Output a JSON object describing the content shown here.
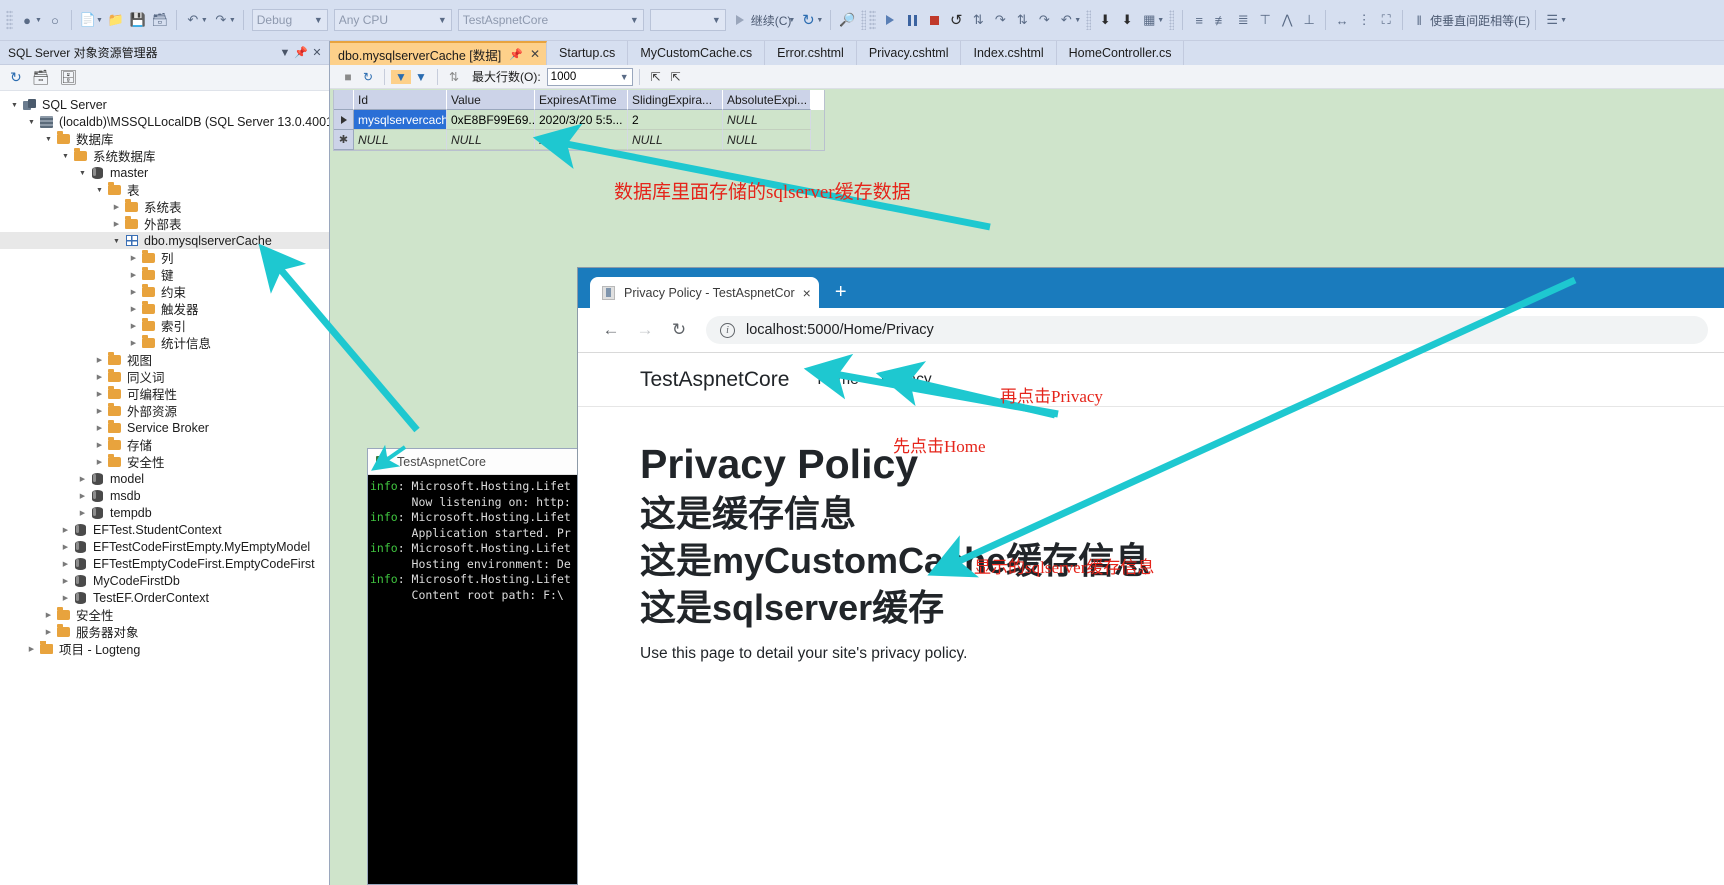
{
  "ide": {
    "toolbar": {
      "config_value": "Debug",
      "platform_value": "Any CPU",
      "startup_project_value": "TestAspnetCore",
      "empty_combo_value": "",
      "continue_label": "继续(C)",
      "spacing_label": "使垂直间距相等(E)"
    },
    "explorer": {
      "title": "SQL Server 对象资源管理器",
      "tree": [
        {
          "depth": 0,
          "label": "SQL Server",
          "icon": "sql-server-icon",
          "twisty": "open",
          "selected": false
        },
        {
          "depth": 1,
          "label": "(localdb)\\MSSQLLocalDB (SQL Server 13.0.4001",
          "icon": "server-icon",
          "twisty": "open",
          "selected": false
        },
        {
          "depth": 2,
          "label": "数据库",
          "icon": "folder-icon",
          "twisty": "open",
          "selected": false
        },
        {
          "depth": 3,
          "label": "系统数据库",
          "icon": "folder-icon",
          "twisty": "open",
          "selected": false
        },
        {
          "depth": 4,
          "label": "master",
          "icon": "database-icon",
          "twisty": "open",
          "selected": false
        },
        {
          "depth": 5,
          "label": "表",
          "icon": "folder-icon",
          "twisty": "open",
          "selected": false
        },
        {
          "depth": 6,
          "label": "系统表",
          "icon": "folder-icon",
          "twisty": "closed",
          "selected": false
        },
        {
          "depth": 6,
          "label": "外部表",
          "icon": "folder-icon",
          "twisty": "closed",
          "selected": false
        },
        {
          "depth": 6,
          "label": "dbo.mysqlserverCache",
          "icon": "table-icon",
          "twisty": "open",
          "selected": true
        },
        {
          "depth": 7,
          "label": "列",
          "icon": "folder-icon",
          "twisty": "closed",
          "selected": false
        },
        {
          "depth": 7,
          "label": "键",
          "icon": "folder-icon",
          "twisty": "closed",
          "selected": false
        },
        {
          "depth": 7,
          "label": "约束",
          "icon": "folder-icon",
          "twisty": "closed",
          "selected": false
        },
        {
          "depth": 7,
          "label": "触发器",
          "icon": "folder-icon",
          "twisty": "closed",
          "selected": false
        },
        {
          "depth": 7,
          "label": "索引",
          "icon": "folder-icon",
          "twisty": "closed",
          "selected": false
        },
        {
          "depth": 7,
          "label": "统计信息",
          "icon": "folder-icon",
          "twisty": "closed",
          "selected": false
        },
        {
          "depth": 5,
          "label": "视图",
          "icon": "folder-icon",
          "twisty": "closed",
          "selected": false
        },
        {
          "depth": 5,
          "label": "同义词",
          "icon": "folder-icon",
          "twisty": "closed",
          "selected": false
        },
        {
          "depth": 5,
          "label": "可编程性",
          "icon": "folder-icon",
          "twisty": "closed",
          "selected": false
        },
        {
          "depth": 5,
          "label": "外部资源",
          "icon": "folder-icon",
          "twisty": "closed",
          "selected": false
        },
        {
          "depth": 5,
          "label": "Service Broker",
          "icon": "folder-icon",
          "twisty": "closed",
          "selected": false
        },
        {
          "depth": 5,
          "label": "存储",
          "icon": "folder-icon",
          "twisty": "closed",
          "selected": false
        },
        {
          "depth": 5,
          "label": "安全性",
          "icon": "folder-icon",
          "twisty": "closed",
          "selected": false
        },
        {
          "depth": 4,
          "label": "model",
          "icon": "database-icon",
          "twisty": "closed",
          "selected": false
        },
        {
          "depth": 4,
          "label": "msdb",
          "icon": "database-icon",
          "twisty": "closed",
          "selected": false
        },
        {
          "depth": 4,
          "label": "tempdb",
          "icon": "database-icon",
          "twisty": "closed",
          "selected": false
        },
        {
          "depth": 3,
          "label": "EFTest.StudentContext",
          "icon": "database-icon",
          "twisty": "closed",
          "selected": false
        },
        {
          "depth": 3,
          "label": "EFTestCodeFirstEmpty.MyEmptyModel",
          "icon": "database-icon",
          "twisty": "closed",
          "selected": false
        },
        {
          "depth": 3,
          "label": "EFTestEmptyCodeFirst.EmptyCodeFirst",
          "icon": "database-icon",
          "twisty": "closed",
          "selected": false
        },
        {
          "depth": 3,
          "label": "MyCodeFirstDb",
          "icon": "database-icon",
          "twisty": "closed",
          "selected": false
        },
        {
          "depth": 3,
          "label": "TestEF.OrderContext",
          "icon": "database-icon",
          "twisty": "closed",
          "selected": false
        },
        {
          "depth": 2,
          "label": "安全性",
          "icon": "folder-icon",
          "twisty": "closed",
          "selected": false
        },
        {
          "depth": 2,
          "label": "服务器对象",
          "icon": "folder-icon",
          "twisty": "closed",
          "selected": false
        },
        {
          "depth": 1,
          "label": "项目 - Logteng",
          "icon": "project-icon",
          "twisty": "closed",
          "selected": false
        }
      ]
    },
    "tabs": [
      {
        "label": "dbo.mysqlserverCache [数据]",
        "active": true
      },
      {
        "label": "Startup.cs",
        "active": false
      },
      {
        "label": "MyCustomCache.cs",
        "active": false
      },
      {
        "label": "Error.cshtml",
        "active": false
      },
      {
        "label": "Privacy.cshtml",
        "active": false
      },
      {
        "label": "Index.cshtml",
        "active": false
      },
      {
        "label": "HomeController.cs",
        "active": false
      }
    ],
    "grid_toolbar": {
      "max_rows_label": "最大行数(O):",
      "max_rows_value": "1000"
    },
    "grid": {
      "columns": [
        "Id",
        "Value",
        "ExpiresAtTime",
        "SlidingExpira...",
        "AbsoluteExpi..."
      ],
      "rows": [
        {
          "selected": true,
          "cells": [
            "mysqlservercache",
            "0xE8BF99E69...",
            "2020/3/20 5:5...",
            "2",
            "NULL"
          ]
        },
        {
          "selected": false,
          "cells": [
            "NULL",
            "NULL",
            "NULL",
            "NULL",
            "NULL"
          ]
        }
      ]
    }
  },
  "console": {
    "title": "TestAspnetCore",
    "lines": [
      {
        "tag": "info",
        "rest": ": Microsoft.Hosting.Lifet"
      },
      {
        "tag": "",
        "rest": "      Now listening on: http:"
      },
      {
        "tag": "info",
        "rest": ": Microsoft.Hosting.Lifet"
      },
      {
        "tag": "",
        "rest": "      Application started. Pr"
      },
      {
        "tag": "info",
        "rest": ": Microsoft.Hosting.Lifet"
      },
      {
        "tag": "",
        "rest": "      Hosting environment: De"
      },
      {
        "tag": "info",
        "rest": ": Microsoft.Hosting.Lifet"
      },
      {
        "tag": "",
        "rest": "      Content root path: F:\\"
      }
    ]
  },
  "browser": {
    "tab_title": "Privacy Policy - TestAspnetCor",
    "new_tab_label": "+",
    "close_label": "×",
    "url": "localhost:5000/Home/Privacy",
    "site": {
      "brand": "TestAspnetCore",
      "nav": [
        "Home",
        "Privacy"
      ],
      "heading": "Privacy Policy",
      "lines": [
        "这是缓存信息",
        "这是myCustomCache缓存信息",
        "这是sqlserver缓存"
      ],
      "paragraph": "Use this page to detail your site's privacy policy."
    }
  },
  "annotations": {
    "db_note": "数据库里面存储的sqlserver缓存数据",
    "privacy_note": "再点击Privacy",
    "home_note": "先点击Home",
    "show_note": "显示的sqlserver缓存信息",
    "arrow_color": "#1ec8d0",
    "text_color": "#e5241a"
  }
}
